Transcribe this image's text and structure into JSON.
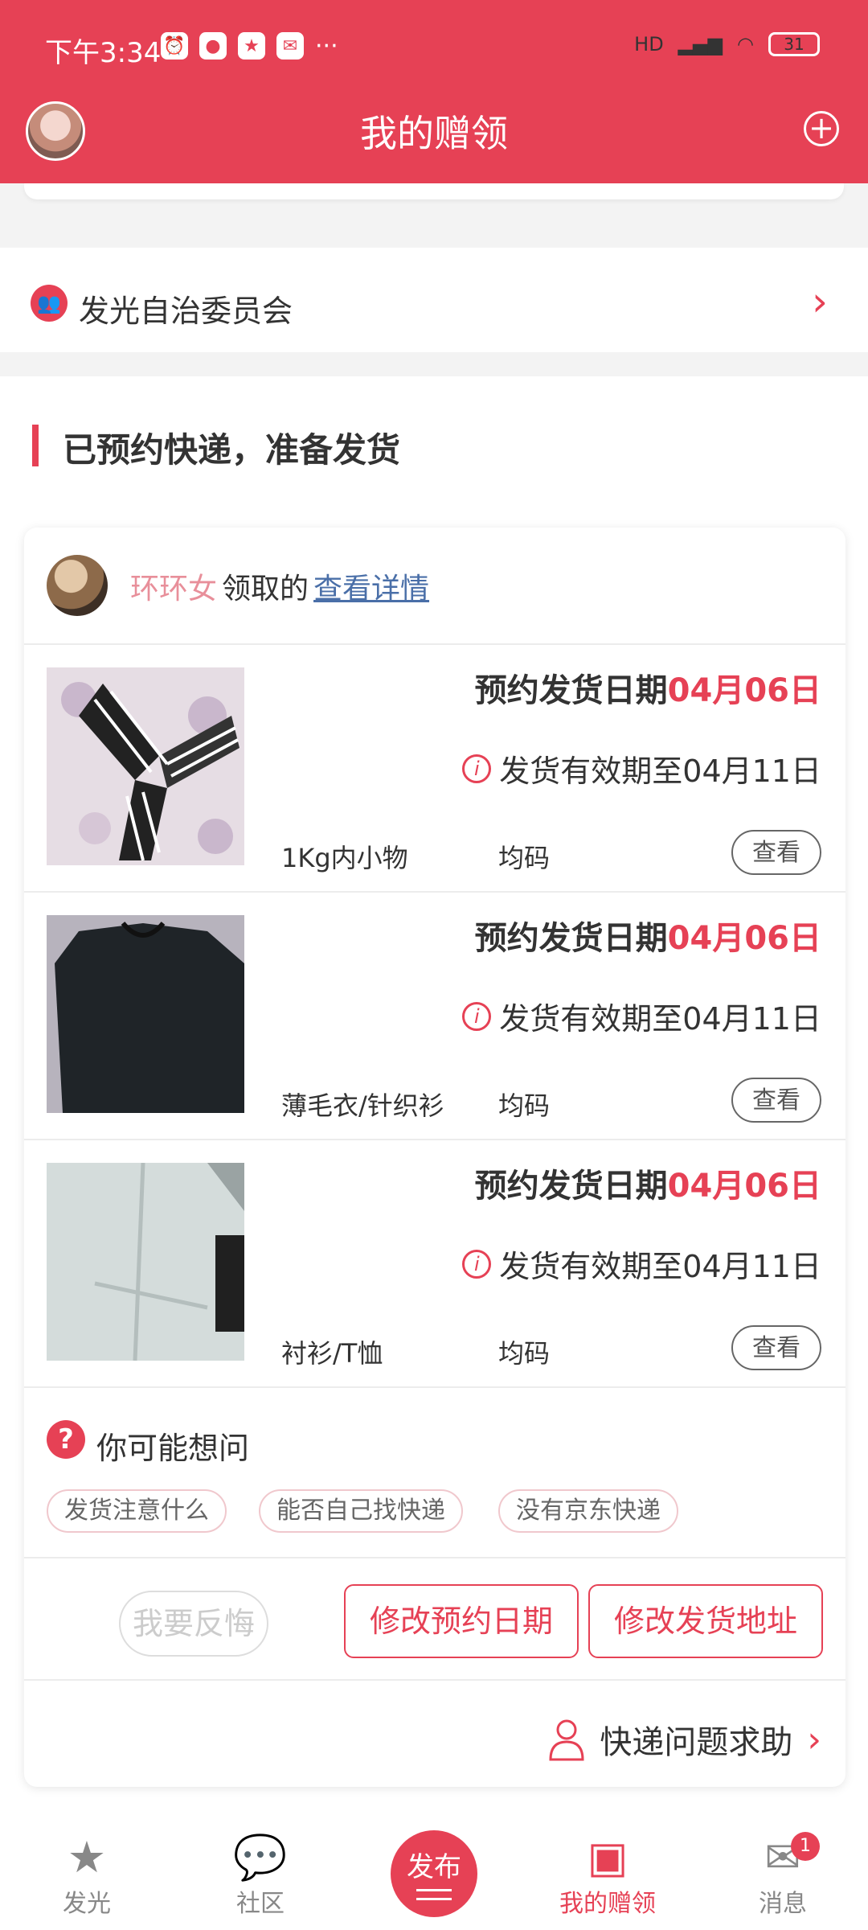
{
  "status": {
    "time": "下午3:34",
    "battery": "31",
    "network": "HD"
  },
  "header": {
    "title": "我的赠领"
  },
  "committee": {
    "label": "发光自治委员会"
  },
  "section": {
    "title": "已预约快递，准备发货"
  },
  "claim": {
    "claimer": "环环女",
    "middle": "领取的",
    "link": "查看详情"
  },
  "items": [
    {
      "date_label": "预约发货日期",
      "date": "04月06日",
      "valid": "发货有效期至04月11日",
      "category": "1Kg内小物",
      "size": "均码",
      "view": "查看"
    },
    {
      "date_label": "预约发货日期",
      "date": "04月06日",
      "valid": "发货有效期至04月11日",
      "category": "薄毛衣/针织衫",
      "size": "均码",
      "view": "查看"
    },
    {
      "date_label": "预约发货日期",
      "date": "04月06日",
      "valid": "发货有效期至04月11日",
      "category": "衬衫/T恤",
      "size": "均码",
      "view": "查看"
    }
  ],
  "faq": {
    "title": "你可能想问",
    "chips": [
      "发货注意什么",
      "能否自己找快递",
      "没有京东快递"
    ]
  },
  "actions": {
    "regret": "我要反悔",
    "change_date": "修改预约日期",
    "change_address": "修改发货地址"
  },
  "help": {
    "label": "快递问题求助"
  },
  "tabs": [
    {
      "label": "发光",
      "icon": "star-icon"
    },
    {
      "label": "社区",
      "icon": "chat-icon"
    },
    {
      "label": "发布",
      "icon": "publish-icon"
    },
    {
      "label": "我的赠领",
      "icon": "gift-box-icon"
    },
    {
      "label": "消息",
      "icon": "mail-icon"
    }
  ],
  "badge_count": "1",
  "colors": {
    "accent": "#e64155"
  }
}
